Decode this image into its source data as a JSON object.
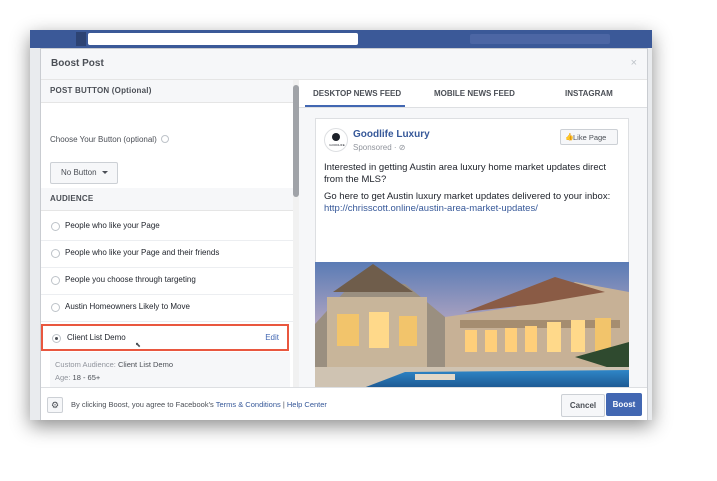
{
  "modal": {
    "title": "Boost Post",
    "close_label": "×"
  },
  "post_button": {
    "section_title": "POST BUTTON (Optional)",
    "choose_label": "Choose Your Button (optional)",
    "selected_value": "No Button"
  },
  "audience": {
    "section_title": "AUDIENCE",
    "options": [
      {
        "label": "People who like your Page"
      },
      {
        "label": "People who like your Page and their friends"
      },
      {
        "label": "People you choose through targeting"
      },
      {
        "label": "Austin Homeowners Likely to Move"
      }
    ],
    "selected": {
      "label": "Client List Demo",
      "edit_label": "Edit"
    },
    "details": {
      "custom_audience_label": "Custom Audience:",
      "custom_audience_value": "Client List Demo",
      "age_label": "Age:",
      "age_value": "18 - 65+"
    }
  },
  "tabs": [
    {
      "label": "DESKTOP NEWS FEED",
      "active": true
    },
    {
      "label": "MOBILE NEWS FEED",
      "active": false
    },
    {
      "label": "INSTAGRAM",
      "active": false
    }
  ],
  "post": {
    "avatar_text": "GOODLIFE",
    "page_name": "Goodlife Luxury",
    "sponsored": "Sponsored · ⊘",
    "like_page_label": "Like Page",
    "text_1": "Interested in getting Austin area luxury home market updates direct from the MLS?",
    "text_2": "Go here to get Austin luxury market updates delivered to your inbox:",
    "link": "http://chrisscott.online/austin-area-market-updates/"
  },
  "footer": {
    "terms_prefix": "By clicking Boost, you agree to Facebook's",
    "terms_link": "Terms & Conditions",
    "separator": "|",
    "help_link": "Help Center",
    "cancel_label": "Cancel",
    "boost_label": "Boost"
  },
  "colors": {
    "brand": "#4267b2",
    "highlight": "#e9573f",
    "link": "#365899"
  }
}
